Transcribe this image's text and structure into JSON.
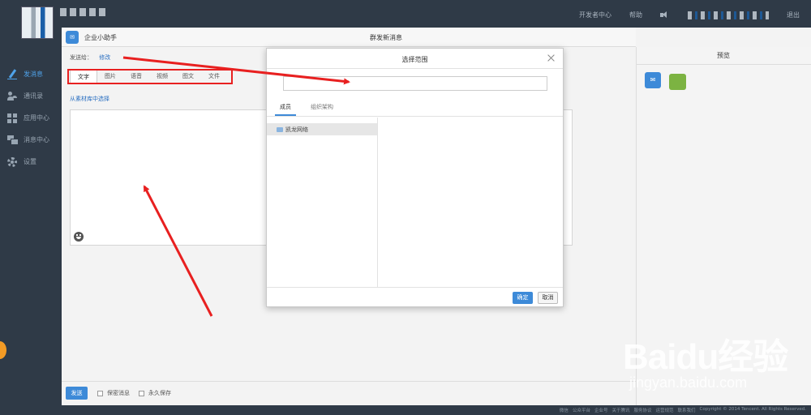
{
  "topbar": {
    "links": [
      "开发者中心",
      "帮助",
      "退出"
    ]
  },
  "sidebar": {
    "items": [
      {
        "label": "发消息",
        "icon": "pencil-icon",
        "active": true
      },
      {
        "label": "通讯录",
        "icon": "people-icon"
      },
      {
        "label": "应用中心",
        "icon": "apps-icon"
      },
      {
        "label": "消息中心",
        "icon": "messages-icon"
      },
      {
        "label": "设置",
        "icon": "gear-icon"
      }
    ]
  },
  "panel": {
    "app_name": "企业小助手",
    "heading": "群发新消息",
    "to_label": "发送给：",
    "to_edit": "修改",
    "message_types": [
      "文字",
      "图片",
      "语音",
      "视频",
      "图文",
      "文件"
    ],
    "from_library": "从素材库中选择",
    "send": "发送",
    "opt_secret": "保密消息",
    "opt_keep": "永久保存",
    "preview": "预览"
  },
  "modal": {
    "title": "选择范围",
    "search_value": "",
    "tabs": [
      "成员",
      "组织架构"
    ],
    "tree_root": "凯龙网络",
    "ok": "确定",
    "cancel": "取消"
  },
  "footer": {
    "links": [
      "微信",
      "公众平台",
      "企业号",
      "关于腾讯",
      "服务协议",
      "运营规范",
      "联系我们",
      "Copyright © 2014 Tencent. All Rights Reserved."
    ]
  },
  "watermark": {
    "brand": "Baidu经验",
    "url": "jingyan.baidu.com"
  },
  "colors": {
    "dark_bg": "#2f3a47",
    "accent_blue": "#3d8ad8",
    "annotation_red": "#e82020"
  }
}
